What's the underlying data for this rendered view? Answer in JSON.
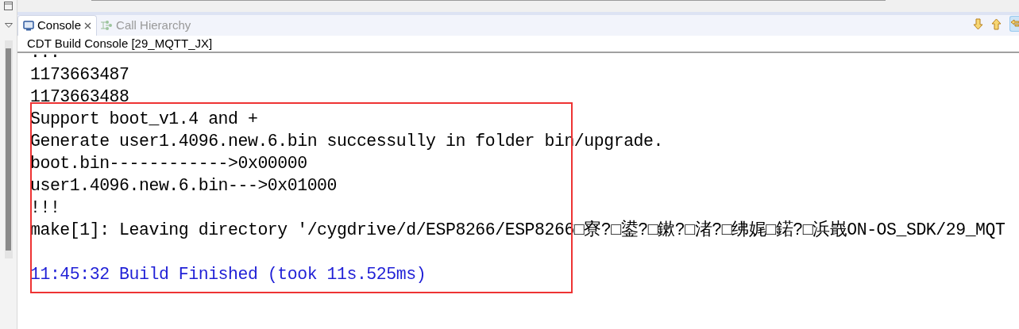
{
  "tabs": [
    {
      "label": "Console",
      "kind": "console",
      "selected": true,
      "closable": true
    },
    {
      "label": "Call Hierarchy",
      "kind": "hierarchy",
      "selected": false,
      "closable": false
    }
  ],
  "console_title": "CDT Build Console [29_MQTT_JX]",
  "lines": [
    {
      "kind": "output",
      "text": "..."
    },
    {
      "kind": "output",
      "text": "1173663487"
    },
    {
      "kind": "output",
      "text": "1173663488"
    },
    {
      "kind": "output",
      "text": "Support boot_v1.4 and +"
    },
    {
      "kind": "output",
      "text": "Generate user1.4096.new.6.bin successully in folder bin/upgrade."
    },
    {
      "kind": "output",
      "text": "boot.bin------------>0x00000"
    },
    {
      "kind": "output",
      "text": "user1.4096.new.6.bin--->0x01000"
    },
    {
      "kind": "output",
      "text": "!!!"
    },
    {
      "kind": "output",
      "text": "make[1]: Leaving directory '/cygdrive/d/ESP8266/ESP8266□寮?□鍙?□鏉?□渚?□绋娓□鍩?□浜嶯ON-OS_SDK/29_MQT"
    },
    {
      "kind": "blank"
    },
    {
      "kind": "status",
      "text": "11:45:32 Build Finished (took 11s.525ms)"
    }
  ]
}
